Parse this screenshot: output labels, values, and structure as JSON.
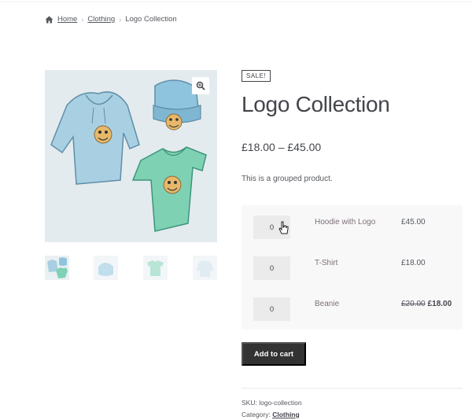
{
  "breadcrumb": {
    "home": "Home",
    "category": "Clothing",
    "current": "Logo Collection"
  },
  "product": {
    "badge": "SALE!",
    "title": "Logo Collection",
    "price_range": "£18.00 – £45.00",
    "description": "This is a grouped product."
  },
  "grouped_items": [
    {
      "qty": "0",
      "name": "Hoodie with Logo",
      "price": "£45.00"
    },
    {
      "qty": "0",
      "name": "T-Shirt",
      "price": "£18.00"
    },
    {
      "qty": "0",
      "name": "Beanie",
      "old_price": "£20.00",
      "sale_price": "£18.00"
    }
  ],
  "actions": {
    "add_to_cart": "Add to cart"
  },
  "meta": {
    "sku_label": "SKU:",
    "sku_value": "logo-collection",
    "category_label": "Category:",
    "category_value": "Clothing"
  },
  "icons": [
    "home-icon",
    "zoom-icon",
    "cursor-icon"
  ],
  "colors": {
    "button": "#333333",
    "link": "#7d6f77",
    "image_bg": "#e3ebef"
  }
}
